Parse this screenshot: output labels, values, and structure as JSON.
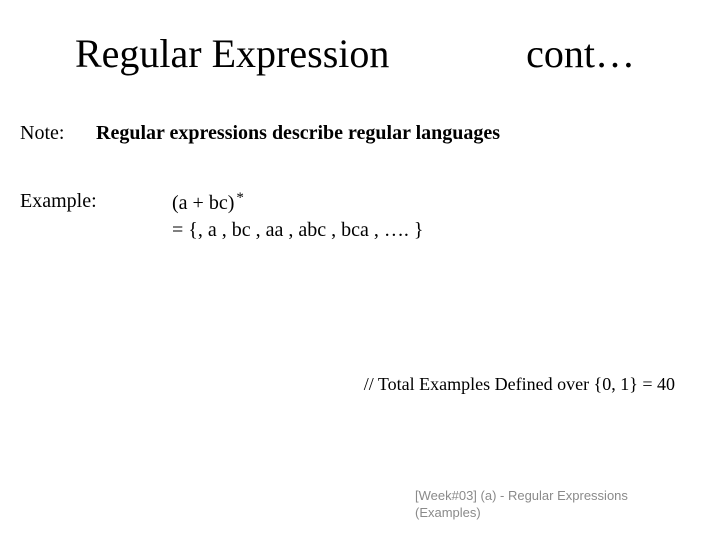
{
  "title": {
    "left": "Regular Expression",
    "right": "cont…"
  },
  "note": {
    "label": "Note:",
    "text": "Regular expressions describe regular languages"
  },
  "example": {
    "label": "Example:",
    "expr_base": "(a + bc)",
    "expr_star": "*",
    "set": "= {, a , bc , aa , abc , bca , …. }"
  },
  "comment": "// Total Examples Defined over {0, 1} = 40",
  "footer": "[Week#03] (a) - Regular Expressions (Examples)"
}
